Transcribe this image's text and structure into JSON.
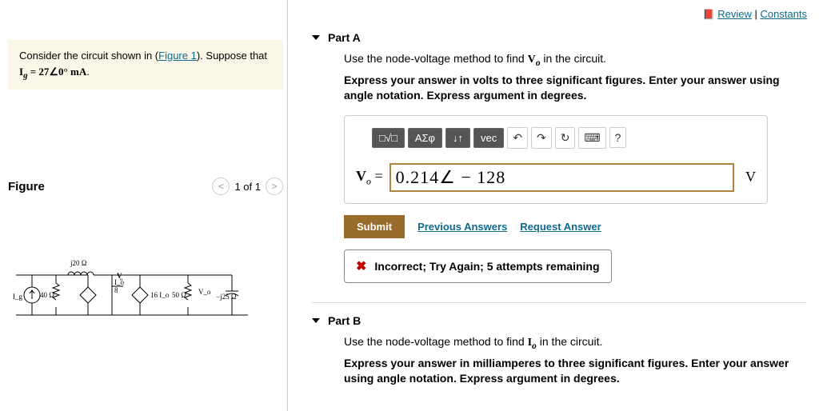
{
  "topbar": {
    "review": "Review",
    "constants": "Constants"
  },
  "problem": {
    "prefix": "Consider the circuit shown in (",
    "figlink": "Figure 1",
    "suffix": "). Suppose that ",
    "equation": "I_g = 27∠0° mA",
    "equation_html_prefix": "I",
    "equation_sub": "g",
    "equation_rest": " = 27∠0° mA"
  },
  "figure": {
    "label": "Figure",
    "pager": "1 of 1"
  },
  "circuit": {
    "ig_label": "I_g",
    "j20": "j20 Ω",
    "r40": "40 Ω",
    "io8_top": "I_o",
    "io8_bot": "8",
    "i16": "16 I_o",
    "r50": "50 Ω",
    "vo": "V_o",
    "jn25": "−j25 Ω"
  },
  "partA": {
    "title": "Part A",
    "prompt_pre": "Use the node-voltage method to find ",
    "prompt_var": "V",
    "prompt_var_sub": "o",
    "prompt_post": " in the circuit.",
    "instr": "Express your answer in volts to three significant figures. Enter your answer using angle notation. Express argument in degrees.",
    "toolbar": [
      "□√□",
      "ΑΣφ",
      "↓↑",
      "vec",
      "↶",
      "↷",
      "↻",
      "⌨",
      "?"
    ],
    "eq_label": "V",
    "eq_sub": "o",
    "eq_assign": " = ",
    "value": "0.214∠ − 128",
    "unit": "V",
    "submit": "Submit",
    "prev": "Previous Answers",
    "req": "Request Answer",
    "feedback": "Incorrect; Try Again; 5 attempts remaining"
  },
  "partB": {
    "title": "Part B",
    "prompt_pre": "Use the node-voltage method to find ",
    "prompt_var": "I",
    "prompt_var_sub": "o",
    "prompt_post": " in the circuit.",
    "instr": "Express your answer in milliamperes to three significant figures. Enter your answer using angle notation. Express argument in degrees."
  }
}
